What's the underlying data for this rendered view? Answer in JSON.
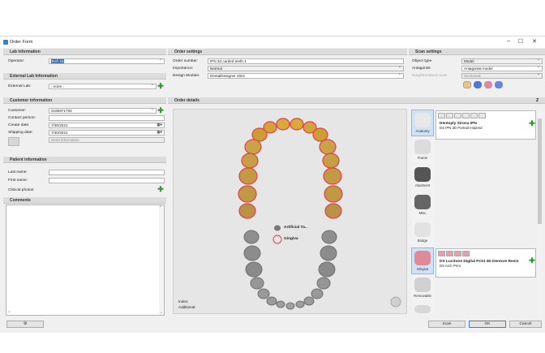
{
  "window": {
    "title": "Order Form",
    "minimize": "–",
    "maximize": "☐",
    "close": "✕"
  },
  "lab": {
    "header": "Lab information",
    "operator_label": "Operator:",
    "operator_value": "Tech 01",
    "external_header": "External Lab Information",
    "external_label": "External Lab:",
    "external_value": "- none -"
  },
  "customer": {
    "header": "Customer information",
    "customer_label": "Customer:",
    "customer_value": "2166971793",
    "contact_label": "Contact person:",
    "contact_value": "",
    "create_label": "Create date:",
    "create_value": "7/30/2021",
    "shipping_label": "Shipping date:",
    "shipping_value": "7/30/2021",
    "send_label": "Send information"
  },
  "patient": {
    "header": "Patient information",
    "last_label": "Last name:",
    "first_label": "First name:",
    "photos_label": "Clinical photos:"
  },
  "comments": {
    "header": "Comments"
  },
  "order_settings": {
    "header": "Order settings",
    "number_label": "Order number:",
    "number_value": "IPN 3d carded teeth-1",
    "importance_label": "Importance:",
    "importance_value": "Normal",
    "module_label": "Design Module:",
    "module_value": "DentalDesigner 2021"
  },
  "order_details": {
    "header": "Order details",
    "legend_artificial": "Artificial To..",
    "legend_gingiva": "Gingiva",
    "index_label": "Index:",
    "additional_label": "Additional:"
  },
  "scan": {
    "header": "Scan settings",
    "object_label": "Object type",
    "object_value": "Model",
    "antagonist_label": "Antagonist",
    "antagonist_value": "Antagonist model",
    "neighbor_label": "Neighbor/stock scan",
    "neighbor_value": "Sectioned"
  },
  "categories": [
    {
      "label": "Anatomy"
    },
    {
      "label": "Frame"
    },
    {
      "label": "Abutment"
    },
    {
      "label": "Misc"
    },
    {
      "label": "Bridge"
    },
    {
      "label": "Gingiva"
    },
    {
      "label": "Removable"
    }
  ],
  "catalog": [
    {
      "title": "Dentsply Sirona IPN",
      "subtitle": "DS IPN 3D Portrait Inspired"
    },
    {
      "title": "DS Lucitone Digital Print 3D Denture Resin",
      "subtitle": "DS Arch Print"
    }
  ],
  "panel_collapse": "Z",
  "footer": {
    "scan": "Scan",
    "ok": "OK",
    "cancel": "Cancel"
  },
  "colors": {
    "accent": "#1b6ad6",
    "gingiva_ring": "#e0414a",
    "plus": "#2f9a2f"
  }
}
